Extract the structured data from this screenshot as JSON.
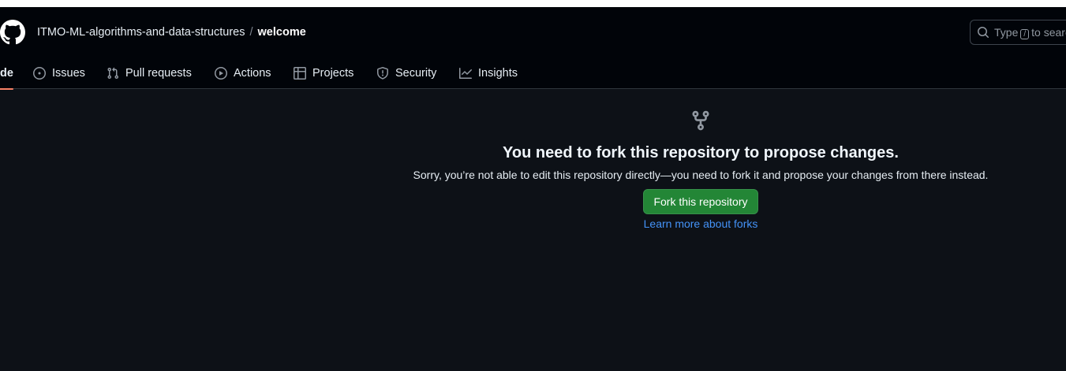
{
  "header": {
    "owner": "ITMO-ML-algorithms-and-data-structures",
    "separator": "/",
    "repo": "welcome",
    "logo_icon": "github-mark-icon"
  },
  "search": {
    "prefix": "Type",
    "key": "/",
    "suffix": "to search"
  },
  "tabs": [
    {
      "label": "de",
      "icon": "code-icon",
      "active": true
    },
    {
      "label": "Issues",
      "icon": "issue-opened-icon"
    },
    {
      "label": "Pull requests",
      "icon": "git-pull-request-icon"
    },
    {
      "label": "Actions",
      "icon": "play-icon"
    },
    {
      "label": "Projects",
      "icon": "table-icon"
    },
    {
      "label": "Security",
      "icon": "shield-icon"
    },
    {
      "label": "Insights",
      "icon": "graph-icon"
    }
  ],
  "main": {
    "icon": "repo-forked-icon",
    "heading": "You need to fork this repository to propose changes.",
    "description": "Sorry, you’re not able to edit this repository directly—you need to fork it and propose your changes from there instead.",
    "fork_button": "Fork this repository",
    "learn_link": "Learn more about forks"
  },
  "colors": {
    "accent_underline": "#f78166",
    "button_green": "#238636",
    "link_blue": "#4493f8",
    "header_bg": "#010409",
    "page_bg": "#0d1117"
  }
}
